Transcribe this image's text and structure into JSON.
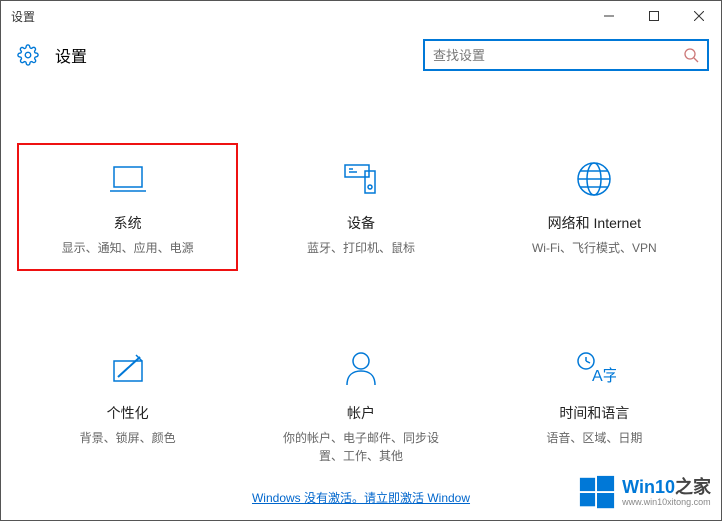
{
  "window": {
    "title": "设置"
  },
  "header": {
    "title": "设置"
  },
  "search": {
    "placeholder": "查找设置"
  },
  "tiles": [
    {
      "title": "系统",
      "desc": "显示、通知、应用、电源",
      "highlight": true
    },
    {
      "title": "设备",
      "desc": "蓝牙、打印机、鼠标",
      "highlight": false
    },
    {
      "title": "网络和 Internet",
      "desc": "Wi-Fi、飞行模式、VPN",
      "highlight": false
    },
    {
      "title": "个性化",
      "desc": "背景、锁屏、颜色",
      "highlight": false
    },
    {
      "title": "帐户",
      "desc": "你的帐户、电子邮件、同步设置、工作、其他",
      "highlight": false
    },
    {
      "title": "时间和语言",
      "desc": "语音、区域、日期",
      "highlight": false
    }
  ],
  "activation": {
    "text": "Windows 没有激活。请立即激活 Window"
  },
  "watermark": {
    "main_w": "Win10",
    "main_zhi": "之家",
    "sub": "www.win10xitong.com"
  }
}
